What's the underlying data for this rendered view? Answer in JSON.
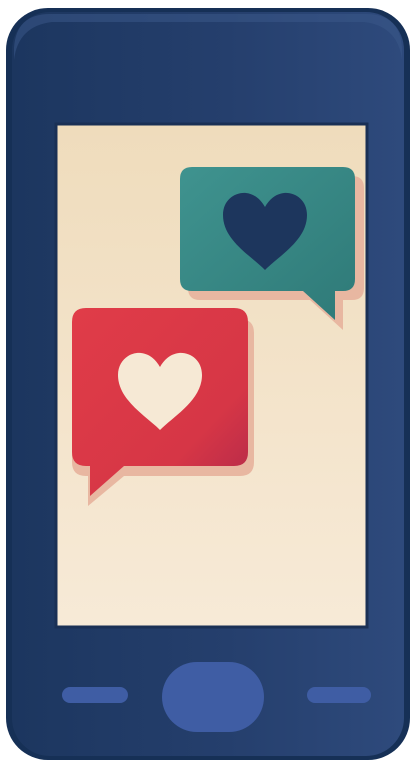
{
  "illustration": {
    "subject": "phone-with-heart-chat-bubbles",
    "icons": [
      "phone-icon",
      "chat-bubble-icon",
      "heart-icon"
    ],
    "colors": {
      "phone_body_dark": "#1c365f",
      "phone_body_light": "#2e4a7c",
      "phone_edge_shadow": "#163056",
      "screen_top": "#efdcbc",
      "screen_bottom": "#f7ead7",
      "bubble_teal": "#3f938f",
      "bubble_teal_dark": "#2f7a78",
      "heart_navy": "#1d365d",
      "bubble_red": "#d93845",
      "bubble_red_dark": "#b82a3f",
      "heart_cream": "#f6e9d5",
      "button_blue": "#3f5da4",
      "bubble_shadow": "#e8b7a1"
    }
  }
}
